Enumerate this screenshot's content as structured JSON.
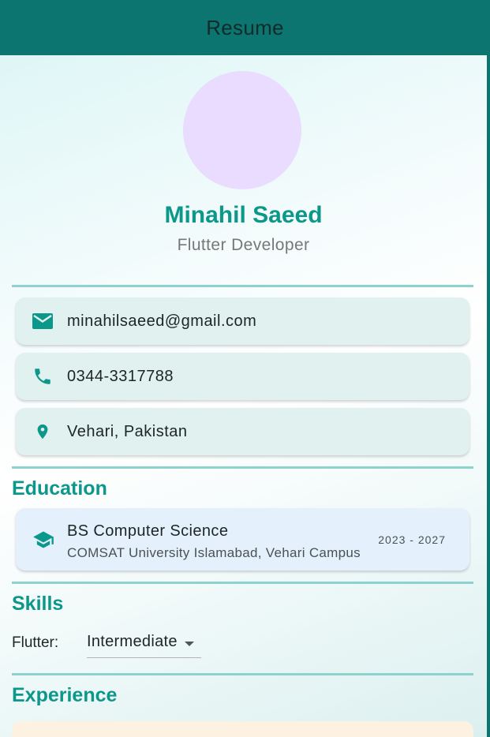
{
  "appbar": {
    "title": "Resume"
  },
  "profile": {
    "name": "Minahil Saeed",
    "role": "Flutter Developer"
  },
  "contacts": [
    {
      "icon": "email-icon",
      "text": "minahilsaeed@gmail.com"
    },
    {
      "icon": "phone-icon",
      "text": "0344-3317788"
    },
    {
      "icon": "location-pin-icon",
      "text": "Vehari, Pakistan"
    }
  ],
  "education": {
    "title": "Education",
    "icon": "graduation-cap-icon",
    "degree": "BS Computer Science",
    "school": "COMSAT University Islamabad, Vehari Campus",
    "years": "2023 - 2027"
  },
  "skills": {
    "title": "Skills",
    "label": "Flutter:",
    "selected": "Intermediate"
  },
  "experience": {
    "title": "Experience"
  },
  "colors": {
    "appbar": "#0d7570",
    "accent": "#0b978a",
    "avatar": "#e9dcfe",
    "contact_card": "#e0f1f0",
    "education_card": "#e4f0fb",
    "experience_card": "#fdf1e2"
  }
}
